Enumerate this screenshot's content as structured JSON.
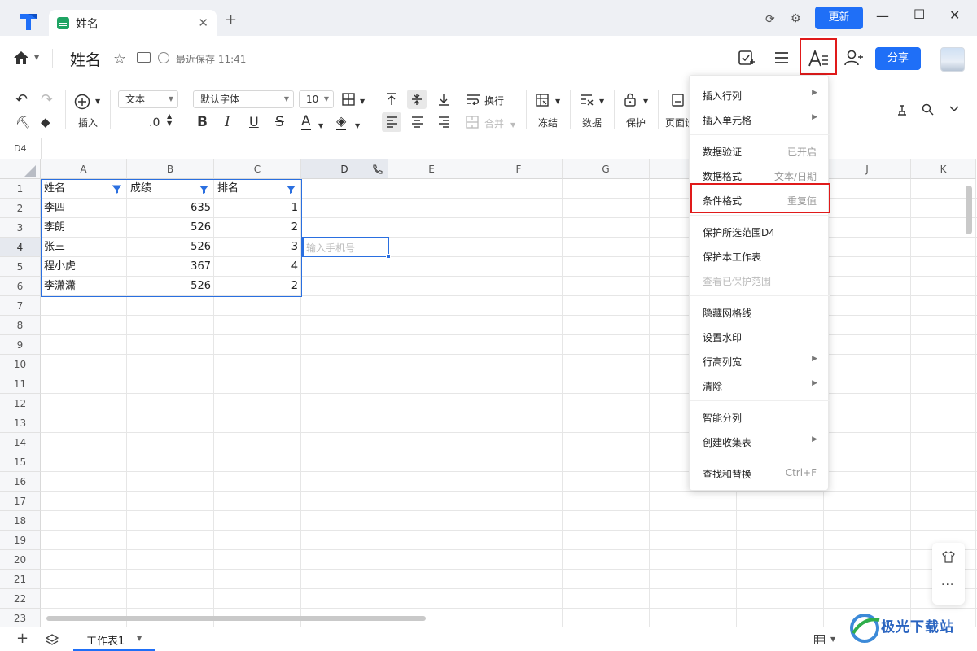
{
  "titlebar": {
    "tab_title": "姓名",
    "update_label": "更新"
  },
  "header": {
    "doc_title": "姓名",
    "save_status": "最近保存 11:41",
    "share_label": "分享"
  },
  "toolbar": {
    "insert_label": "插入",
    "format_select": "文本",
    "decimal_label": ".0",
    "font_select": "默认字体",
    "font_size": "10",
    "wrap_label": "换行",
    "merge_label": "合并",
    "freeze_label": "冻结",
    "data_label": "数据",
    "protect_label": "保护",
    "page_label": "页面设"
  },
  "formula_bar": {
    "cell_ref": "D4"
  },
  "grid": {
    "columns": [
      "A",
      "B",
      "C",
      "D",
      "E",
      "F",
      "G",
      "H",
      "I",
      "J",
      "K"
    ],
    "rows": [
      "1",
      "2",
      "3",
      "4",
      "5",
      "6",
      "7",
      "8",
      "9",
      "10",
      "11",
      "12",
      "13",
      "14",
      "15",
      "16",
      "17",
      "18",
      "19",
      "20",
      "21",
      "22",
      "23"
    ],
    "headers": [
      "姓名",
      "成绩",
      "排名"
    ],
    "data": [
      [
        "李四",
        "635",
        "1"
      ],
      [
        "李朗",
        "526",
        "2"
      ],
      [
        "张三",
        "526",
        "3"
      ],
      [
        "程小虎",
        "367",
        "4"
      ],
      [
        "李潇潇",
        "526",
        "2"
      ]
    ],
    "active_cell_placeholder": "输入手机号"
  },
  "menu": {
    "items": [
      {
        "label": "插入行列",
        "right": "",
        "submenu": true
      },
      {
        "label": "插入单元格",
        "right": "",
        "submenu": true
      },
      {
        "label": "数据验证",
        "right": "已开启",
        "submenu": false
      },
      {
        "label": "数据格式",
        "right": "文本/日期",
        "submenu": false
      },
      {
        "label": "条件格式",
        "right": "重复值",
        "submenu": false
      },
      {
        "label": "保护所选范围D4",
        "right": "",
        "submenu": false
      },
      {
        "label": "保护本工作表",
        "right": "",
        "submenu": false
      },
      {
        "label": "查看已保护范围",
        "right": "",
        "submenu": false,
        "disabled": true
      },
      {
        "label": "隐藏网格线",
        "right": "",
        "submenu": false
      },
      {
        "label": "设置水印",
        "right": "",
        "submenu": false
      },
      {
        "label": "行高列宽",
        "right": "",
        "submenu": true
      },
      {
        "label": "清除",
        "right": "",
        "submenu": true
      },
      {
        "label": "智能分列",
        "right": "",
        "submenu": false
      },
      {
        "label": "创建收集表",
        "right": "",
        "submenu": true
      },
      {
        "label": "查找和替换",
        "right": "Ctrl+F",
        "submenu": false
      }
    ]
  },
  "bottom": {
    "sheet_name": "工作表1"
  },
  "colors": {
    "accent": "#1f6ff7",
    "highlight_red": "#e01a1a",
    "sheet_green": "#1fa463"
  },
  "icons": [
    "app-logo-icon",
    "sheet-icon",
    "close-icon",
    "plus-icon",
    "sync-icon",
    "settings-icon",
    "minimize-icon",
    "maximize-icon",
    "window-close-icon",
    "home-icon",
    "star-icon",
    "move-icon",
    "saved-check-icon",
    "task-icon",
    "menu-icon",
    "text-format-icon",
    "add-user-icon",
    "undo-icon",
    "redo-icon",
    "format-painter-icon",
    "eraser-icon",
    "insert-plus-icon",
    "border-icon",
    "align-top-icon",
    "align-middle-icon",
    "align-bottom-icon",
    "wrap-icon",
    "align-left-icon",
    "align-center-icon",
    "align-right-icon",
    "merge-icon",
    "freeze-icon",
    "data-icon",
    "lock-icon",
    "page-icon",
    "brush-icon",
    "search-icon",
    "chevron-down-icon",
    "filter-icon",
    "phone-icon",
    "layers-icon",
    "shirt-icon",
    "more-icon",
    "grid-view-icon"
  ],
  "watermark_text": "极光下载站"
}
